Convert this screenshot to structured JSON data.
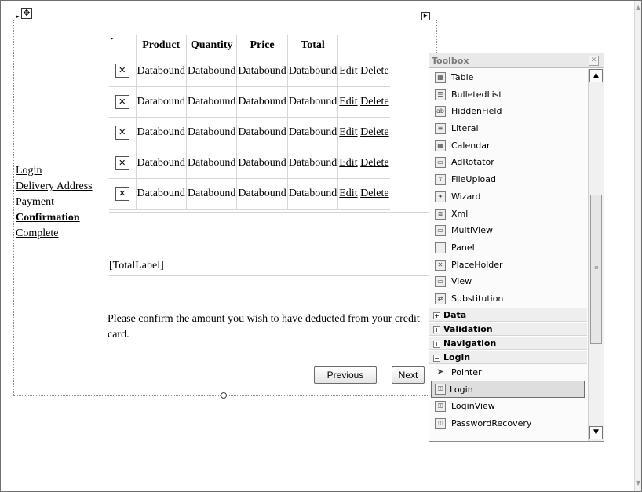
{
  "design_surface": {
    "nav_links": [
      {
        "label": "Login",
        "bold": false
      },
      {
        "label": "Delivery Address",
        "bold": false
      },
      {
        "label": "Payment",
        "bold": false
      },
      {
        "label": "Confirmation",
        "bold": true
      },
      {
        "label": "Complete",
        "bold": false
      }
    ],
    "grid": {
      "headers": [
        "Product",
        "Quantity",
        "Price",
        "Total"
      ],
      "rows": [
        {
          "product": "Databound",
          "quantity": "Databound",
          "price": "Databound",
          "total": "Databound",
          "edit": "Edit",
          "delete": "Delete"
        },
        {
          "product": "Databound",
          "quantity": "Databound",
          "price": "Databound",
          "total": "Databound",
          "edit": "Edit",
          "delete": "Delete"
        },
        {
          "product": "Databound",
          "quantity": "Databound",
          "price": "Databound",
          "total": "Databound",
          "edit": "Edit",
          "delete": "Delete"
        },
        {
          "product": "Databound",
          "quantity": "Databound",
          "price": "Databound",
          "total": "Databound",
          "edit": "Edit",
          "delete": "Delete"
        },
        {
          "product": "Databound",
          "quantity": "Databound",
          "price": "Databound",
          "total": "Databound",
          "edit": "Edit",
          "delete": "Delete"
        }
      ]
    },
    "total_label": "[TotalLabel]",
    "confirm_text": "Please confirm the amount you wish to have deducted from your credit card.",
    "buttons": {
      "previous": "Previous",
      "next": "Next"
    }
  },
  "toolbox": {
    "title": "Toolbox",
    "items_top": [
      {
        "label": "Table",
        "icon": "table-icon",
        "glyph": "▦"
      },
      {
        "label": "BulletedList",
        "icon": "bulleted-list-icon",
        "glyph": "☰"
      },
      {
        "label": "HiddenField",
        "icon": "hidden-field-icon",
        "glyph": "ab"
      },
      {
        "label": "Literal",
        "icon": "literal-icon",
        "glyph": "≡"
      },
      {
        "label": "Calendar",
        "icon": "calendar-icon",
        "glyph": "▦"
      },
      {
        "label": "AdRotator",
        "icon": "ad-rotator-icon",
        "glyph": "▭"
      },
      {
        "label": "FileUpload",
        "icon": "file-upload-icon",
        "glyph": "⇪"
      },
      {
        "label": "Wizard",
        "icon": "wizard-icon",
        "glyph": "✦"
      },
      {
        "label": "Xml",
        "icon": "xml-icon",
        "glyph": "≣"
      },
      {
        "label": "MultiView",
        "icon": "multiview-icon",
        "glyph": "▭"
      },
      {
        "label": "Panel",
        "icon": "panel-icon",
        "glyph": " "
      },
      {
        "label": "PlaceHolder",
        "icon": "placeholder-icon",
        "glyph": "✕"
      },
      {
        "label": "View",
        "icon": "view-icon",
        "glyph": "▭"
      },
      {
        "label": "Substitution",
        "icon": "substitution-icon",
        "glyph": "⇄"
      }
    ],
    "categories": [
      {
        "label": "Data",
        "expander": "+"
      },
      {
        "label": "Validation",
        "expander": "+"
      },
      {
        "label": "Navigation",
        "expander": "+"
      },
      {
        "label": "Login",
        "expander": "−"
      }
    ],
    "items_login": [
      {
        "label": "Pointer",
        "icon": "pointer-icon",
        "glyph": "➤",
        "selected": false
      },
      {
        "label": "Login",
        "icon": "login-icon",
        "glyph": "⚿",
        "selected": true
      },
      {
        "label": "LoginView",
        "icon": "login-view-icon",
        "glyph": "⚿",
        "selected": false
      },
      {
        "label": "PasswordRecovery",
        "icon": "password-recovery-icon",
        "glyph": "⚿",
        "selected": false
      }
    ]
  }
}
